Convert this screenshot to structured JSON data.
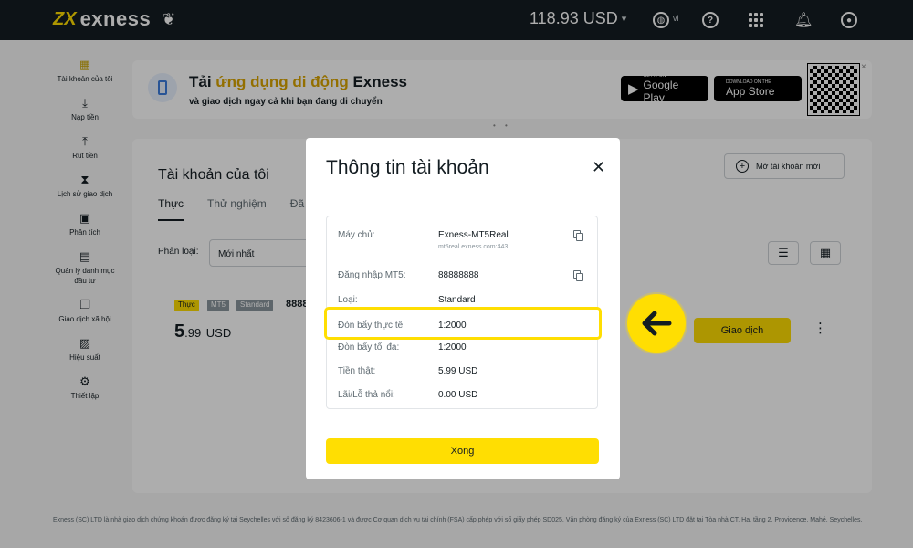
{
  "topbar": {
    "logo_mark": "ZX",
    "logo_text": "exness",
    "balance": "118.93 USD",
    "language": "vi"
  },
  "sidebar": {
    "items": [
      {
        "label": "Tài khoản của tôi",
        "icon": "accounts-grid-icon"
      },
      {
        "label": "Nạp tiền",
        "icon": "deposit-icon"
      },
      {
        "label": "Rút tiền",
        "icon": "withdraw-icon"
      },
      {
        "label": "Lịch sử giao dịch",
        "icon": "hourglass-icon"
      },
      {
        "label": "Phân tích",
        "icon": "analytics-icon"
      },
      {
        "label": "Quản lý danh mục đầu tư",
        "icon": "briefcase-icon"
      },
      {
        "label": "Giao dịch xã hội",
        "icon": "social-trading-icon"
      },
      {
        "label": "Hiệu suất",
        "icon": "performance-icon"
      },
      {
        "label": "Thiết lập",
        "icon": "settings-gear-icon"
      }
    ]
  },
  "promo": {
    "title_prefix": "Tải ",
    "title_highlight": "ứng dụng di động",
    "title_suffix": " Exness",
    "subtitle": "và giao dịch ngay cả khi bạn đang di chuyển",
    "google_play_small": "GET IT ON",
    "google_play": "Google Play",
    "app_store_small": "Download on the",
    "app_store": "App Store"
  },
  "accounts": {
    "title": "Tài khoản của tôi",
    "open_new": "Mở tài khoản mới",
    "tabs": [
      "Thực",
      "Thử nghiệm",
      "Đã"
    ],
    "sort_label": "Phân loại:",
    "sort_value": "Mới nhất",
    "row": {
      "badges": [
        "Thực",
        "MT5",
        "Standard"
      ],
      "number": "8888",
      "balance_int": "5",
      "balance_dec": ".99",
      "currency": "USD",
      "trade_button": "Giao dịch"
    }
  },
  "modal": {
    "title": "Thông tin tài khoản",
    "rows": [
      {
        "label": "Máy chủ:",
        "value": "Exness-MT5Real",
        "sub": "mt5real.exness.com:443",
        "copy": true
      },
      {
        "label": "Đăng nhập MT5:",
        "value": "88888888",
        "copy": true
      },
      {
        "label": "Loại:",
        "value": "Standard"
      },
      {
        "label": "Đòn bẩy thực tế:",
        "value": "1:2000",
        "highlight": true
      },
      {
        "label": "Đòn bẩy tối đa:",
        "value": "1:2000"
      },
      {
        "label": "Tiền thật:",
        "value": "5.99 USD"
      },
      {
        "label": "Lãi/Lỗ thả nổi:",
        "value": "0.00 USD"
      }
    ],
    "done_button": "Xong"
  },
  "footer": {
    "text": "Exness (SC) LTD là nhà giao dịch chứng khoán được đăng ký tại Seychelles với số đăng ký 8423606-1 và được Cơ quan dịch vụ tài chính (FSA) cấp phép với số giấy phép SD025. Văn phòng đăng ký của Exness (SC) LTD đặt tại Tòa nhà CT, Ha, tầng 2, Providence, Mahé, Seychelles."
  },
  "colors": {
    "brand_yellow": "#ffde02",
    "topbar": "#141d22",
    "text_dark": "#141d22",
    "text_muted": "#5e6a71"
  }
}
